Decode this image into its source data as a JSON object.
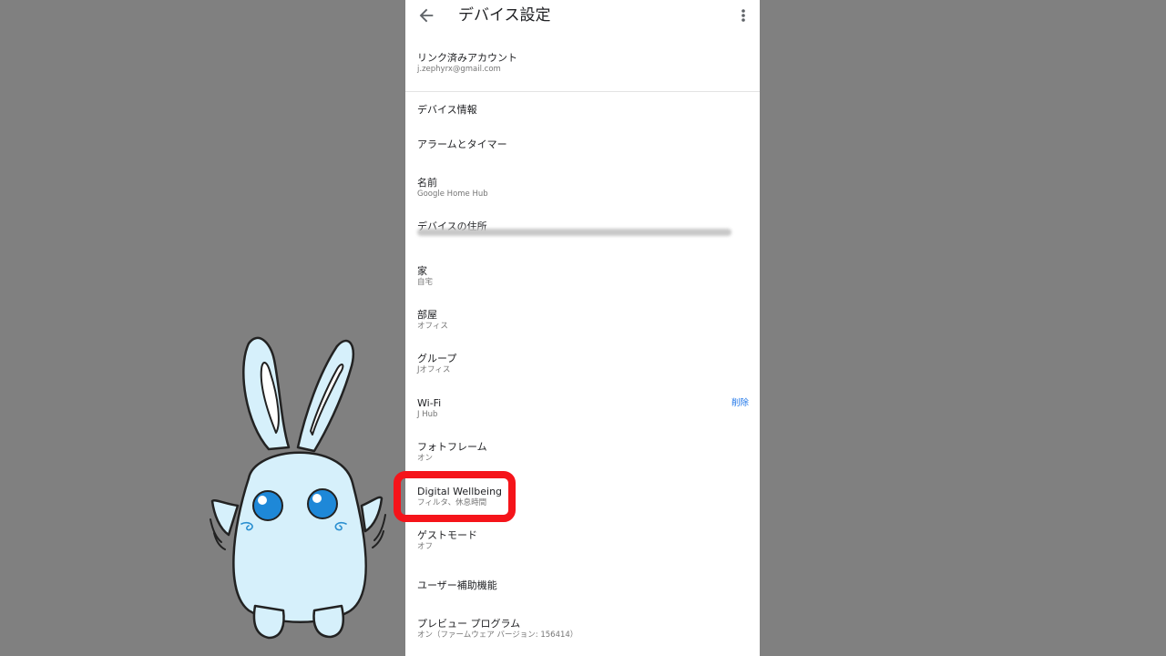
{
  "appbar": {
    "title": "デバイス設定",
    "back_icon": "arrow-back-icon",
    "more_icon": "more-vert-icon"
  },
  "items": [
    {
      "label": "リンク済みアカウント",
      "sub": "j.zephyrx@gmail.com"
    },
    {
      "label": "デバイス情報"
    },
    {
      "label": "アラームとタイマー"
    },
    {
      "label": "名前",
      "sub": "Google Home Hub"
    },
    {
      "label": "デバイスの住所",
      "sub_hidden": true
    },
    {
      "label": "家",
      "sub": "自宅"
    },
    {
      "label": "部屋",
      "sub": "オフィス"
    },
    {
      "label": "グループ",
      "sub": "Jオフィス"
    },
    {
      "label": "Wi-Fi",
      "sub": "J Hub",
      "action": "削除"
    },
    {
      "label": "フォトフレーム",
      "sub": "オン"
    },
    {
      "label": "Digital Wellbeing",
      "sub": "フィルタ、休息時間"
    },
    {
      "label": "ゲストモード",
      "sub": "オフ"
    },
    {
      "label": "ユーザー補助機能"
    },
    {
      "label": "プレビュー プログラム",
      "sub": "オン（ファームウェア バージョン: 156414）"
    }
  ],
  "colors": {
    "background": "#808080",
    "highlight": "#f5141a",
    "accent": "#1a73e8",
    "mascot_fill": "#d6f0fb",
    "mascot_eye": "#1e88d8"
  }
}
